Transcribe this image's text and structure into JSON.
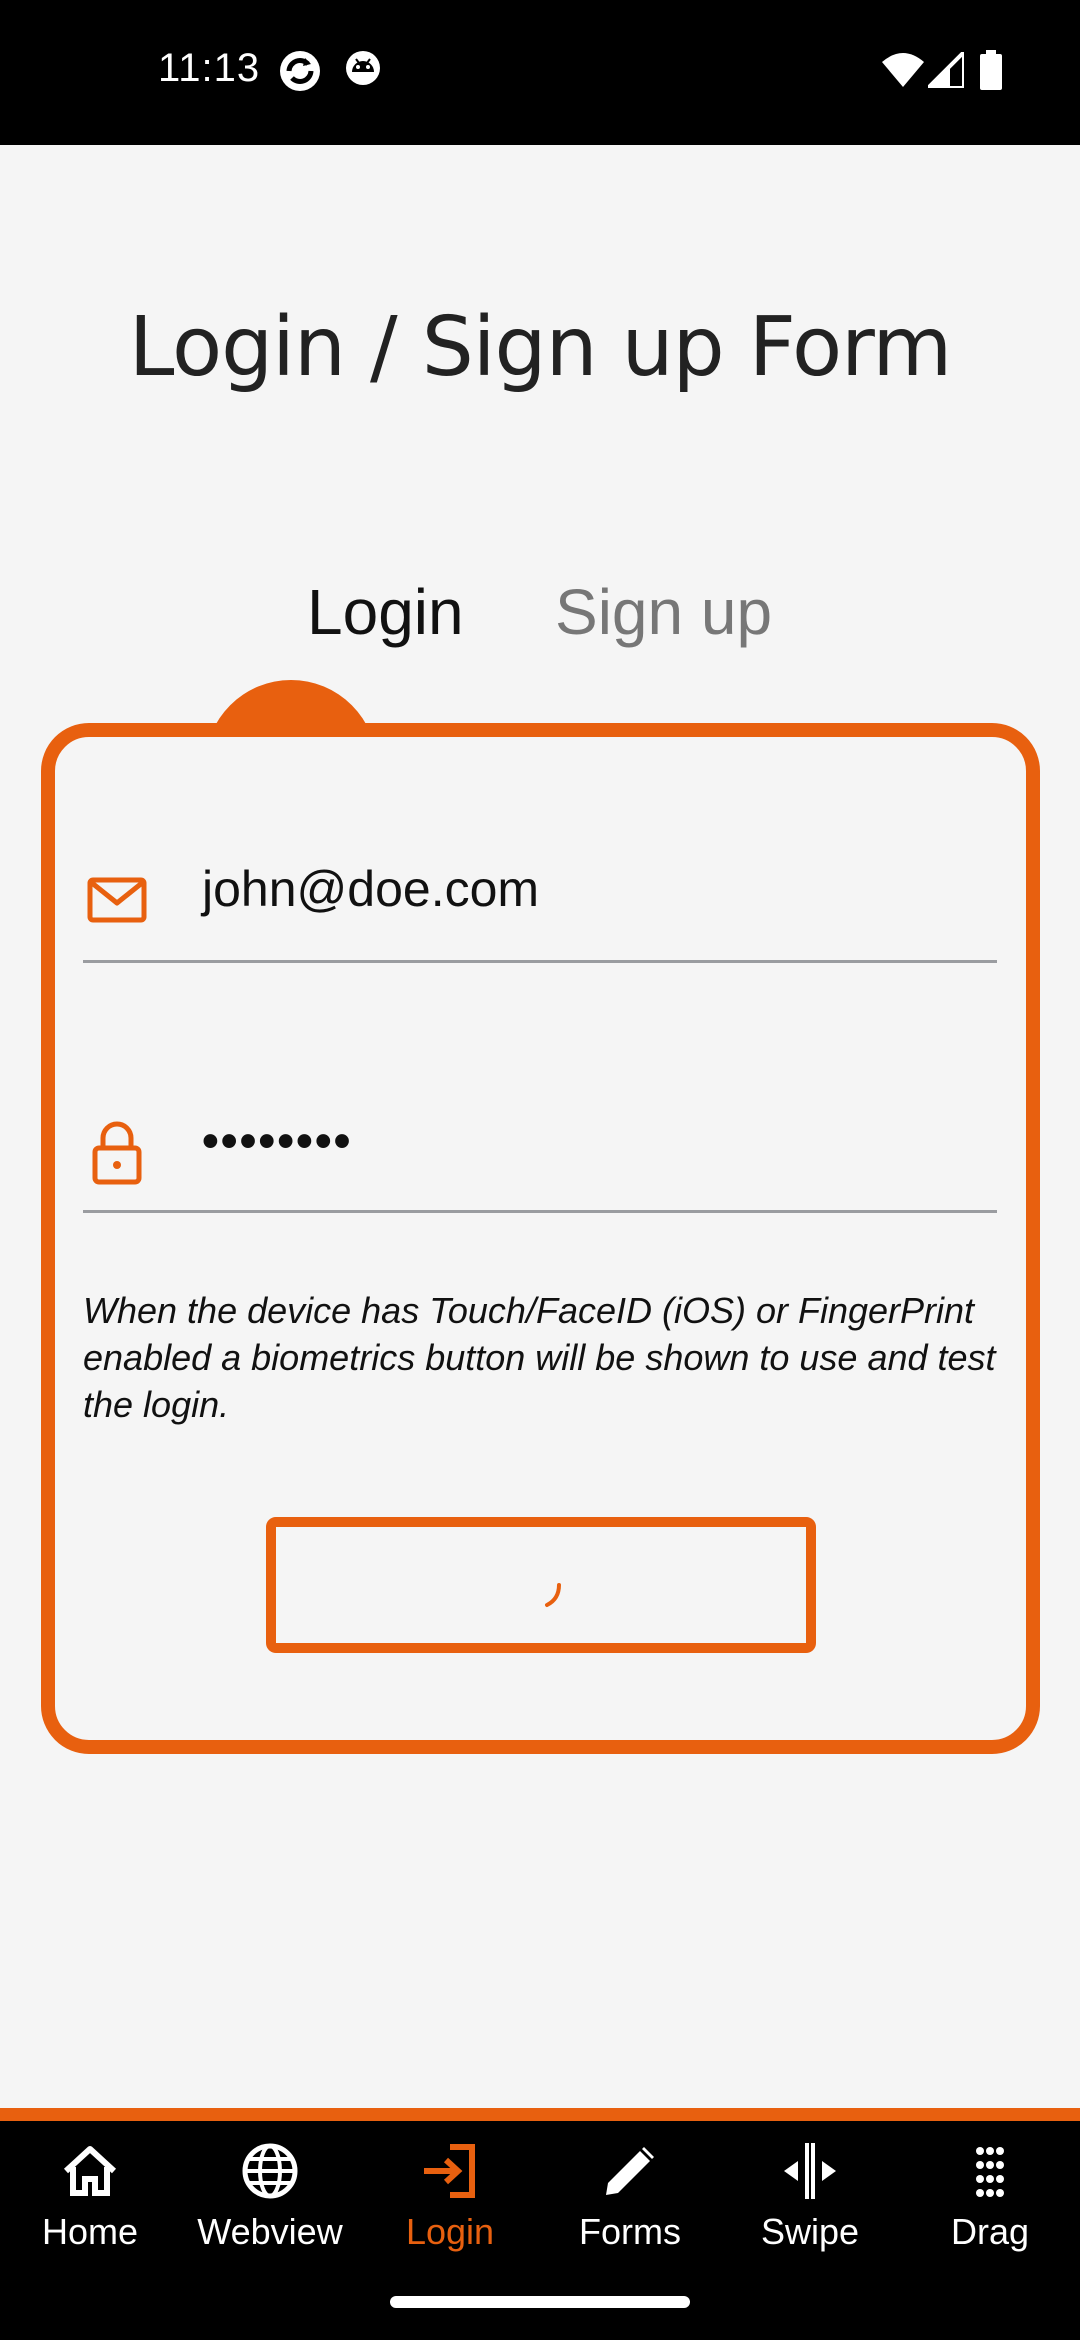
{
  "status_bar": {
    "time": "11:13",
    "icons": [
      "sync-app-icon",
      "android-debug-icon",
      "wifi-icon",
      "cellular-signal-icon",
      "battery-icon"
    ]
  },
  "page": {
    "title": "Login / Sign up Form"
  },
  "tabs": {
    "login_label": "Login",
    "signup_label": "Sign up",
    "active": "Login"
  },
  "form": {
    "email": {
      "icon": "mail-icon",
      "value": "john@doe.com"
    },
    "password": {
      "icon": "lock-icon",
      "value": "••••••••"
    },
    "hint": "When the device has Touch/FaceID (iOS) or FingerPrint enabled a biometrics button will be shown to use and test the login.",
    "login_button": {
      "state": "loading",
      "icon": "loading-spinner-icon"
    }
  },
  "bottom_nav": {
    "items": [
      {
        "label": "Home",
        "icon": "home-icon"
      },
      {
        "label": "Webview",
        "icon": "globe-icon"
      },
      {
        "label": "Login",
        "icon": "login-icon",
        "active": true
      },
      {
        "label": "Forms",
        "icon": "pencil-icon"
      },
      {
        "label": "Swipe",
        "icon": "swipe-icon"
      },
      {
        "label": "Drag",
        "icon": "drag-grid-icon"
      }
    ]
  },
  "colors": {
    "accent": "#e8600f",
    "background": "#f5f5f5",
    "status_bar": "#000000",
    "nav_background": "#000000",
    "divider": "#9a9ca0"
  }
}
